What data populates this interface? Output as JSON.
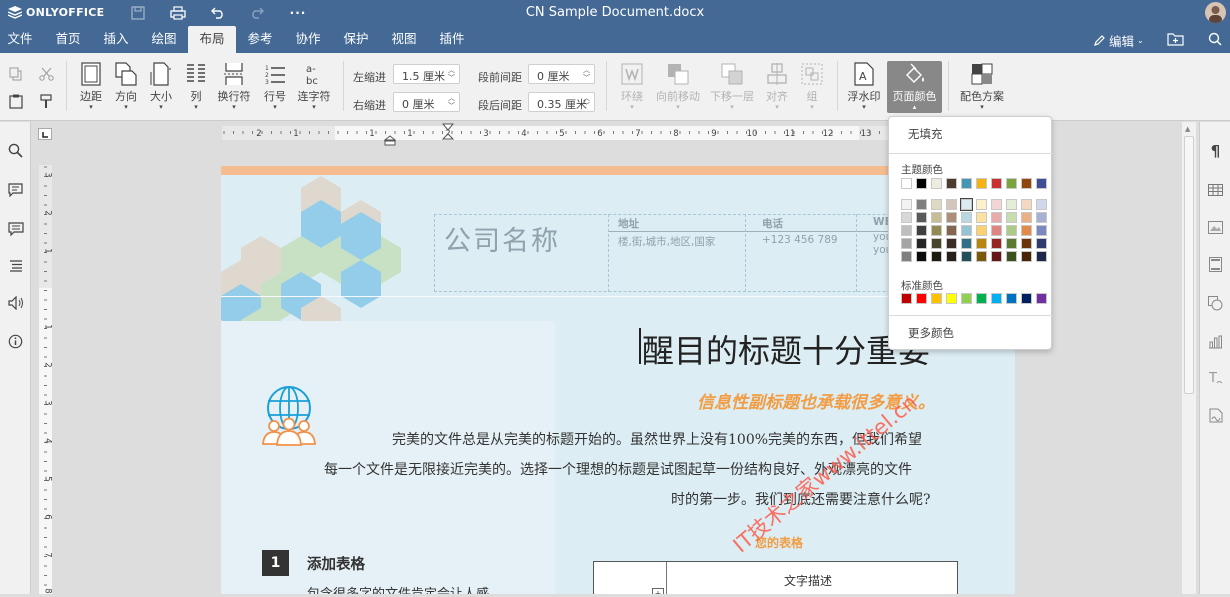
{
  "titlebar": {
    "logo_text": "ONLYOFFICE",
    "doc_title": "CN Sample Document.docx"
  },
  "tabs": [
    "文件",
    "首页",
    "插入",
    "绘图",
    "布局",
    "参考",
    "协作",
    "保护",
    "视图",
    "插件"
  ],
  "active_tab": "布局",
  "header_right": {
    "edit_label": "编辑"
  },
  "toolbar": {
    "margins": "边距",
    "orientation": "方向",
    "size": "大小",
    "columns": "列",
    "breaks": "换行符",
    "line_numbers": "行号",
    "hyphenation": "连字符",
    "indent_left_label": "左缩进",
    "indent_left_value": "1.5 厘米",
    "indent_right_label": "右缩进",
    "indent_right_value": "0 厘米",
    "spacing_before_label": "段前间距",
    "spacing_before_value": "0 厘米",
    "spacing_after_label": "段后间距",
    "spacing_after_value": "0.35 厘米",
    "wrap": "环绕",
    "bring_forward": "向前移动",
    "send_backward": "下移一层",
    "align": "对齐",
    "group": "组",
    "watermark": "浮水印",
    "page_color": "页面颜色",
    "color_scheme": "配色方案"
  },
  "dropdown": {
    "no_fill": "无填充",
    "theme_colors_title": "主题颜色",
    "standard_colors_title": "标准颜色",
    "more_colors": "更多颜色",
    "theme_row": [
      "#ffffff",
      "#000000",
      "#eeece1",
      "#4e3b30",
      "#4596b4",
      "#f5b313",
      "#ca2f30",
      "#7aa43d",
      "#91460e",
      "#3f4e95"
    ],
    "theme_shades": [
      [
        "#f2f2f2",
        "#7f7f7f",
        "#ddd9c3",
        "#d5c6bb",
        "#dbebf1",
        "#fdf0cf",
        "#f4d5d5",
        "#e4edd7",
        "#f5d8c2",
        "#d3d7ea"
      ],
      [
        "#d8d8d8",
        "#595959",
        "#c4bd97",
        "#ac8e79",
        "#b7d7e3",
        "#fce19f",
        "#e9acac",
        "#c9dcaf",
        "#ebb186",
        "#a7b0d5"
      ],
      [
        "#bfbfbf",
        "#3f3f3f",
        "#938953",
        "#836550",
        "#93c3d5",
        "#fad26f",
        "#df8383",
        "#afca88",
        "#e18a4a",
        "#7b89c0"
      ],
      [
        "#a5a5a5",
        "#262626",
        "#494429",
        "#3b2c24",
        "#337087",
        "#b8860e",
        "#972324",
        "#5c7b2e",
        "#6c340b",
        "#2f3a70"
      ],
      [
        "#7f7f7f",
        "#0c0c0c",
        "#1d1b10",
        "#27201a",
        "#22505a",
        "#7a5a09",
        "#651718",
        "#3d521e",
        "#482307",
        "#1f274a"
      ]
    ],
    "standard_row": [
      "#c00000",
      "#ff0000",
      "#ffc000",
      "#ffff00",
      "#92d050",
      "#00b050",
      "#00b0f0",
      "#0070c0",
      "#002060",
      "#7030a0"
    ]
  },
  "document": {
    "company": "公司名称",
    "col_address_label": "地址",
    "col_address_value": "楼,街,城市,地区,国家",
    "col_phone_label": "电话",
    "col_phone_value": "+123 456 789",
    "col_web_label": "WE",
    "col_web_value1": "you",
    "col_web_value2": "you",
    "main_title": "醒目的标题十分重要",
    "subtitle": "信息性副标题也承载很多意义。",
    "para_line1": "完美的文件总是从完美的标题开始的。虽然世界上没有100%完美的东西，但我们希望",
    "para_line2": "每一个文件是无限接近完美的。选择一个理想的标题是试图起草一份结构良好、外观漂亮的文件",
    "para_line3": "时的第一步。我们到底还需要注意什么呢?",
    "table_title": "您的表格",
    "table_header": "文字描述",
    "section_number": "1",
    "section_title": "添加表格",
    "section_body": "包含很多字的文件肯定会让人感",
    "watermark": "IT技术之家www.ittel.cn"
  },
  "ruler": {
    "h_labels": [
      "2",
      "1",
      "1",
      "1",
      "2",
      "3",
      "4",
      "5",
      "6",
      "7",
      "8",
      "9",
      "10",
      "11",
      "12",
      "13",
      "14",
      "15",
      "16"
    ],
    "v_labels": [
      "3",
      "2",
      "1",
      "1",
      "2",
      "3",
      "4",
      "5",
      "6",
      "7",
      "8"
    ]
  }
}
